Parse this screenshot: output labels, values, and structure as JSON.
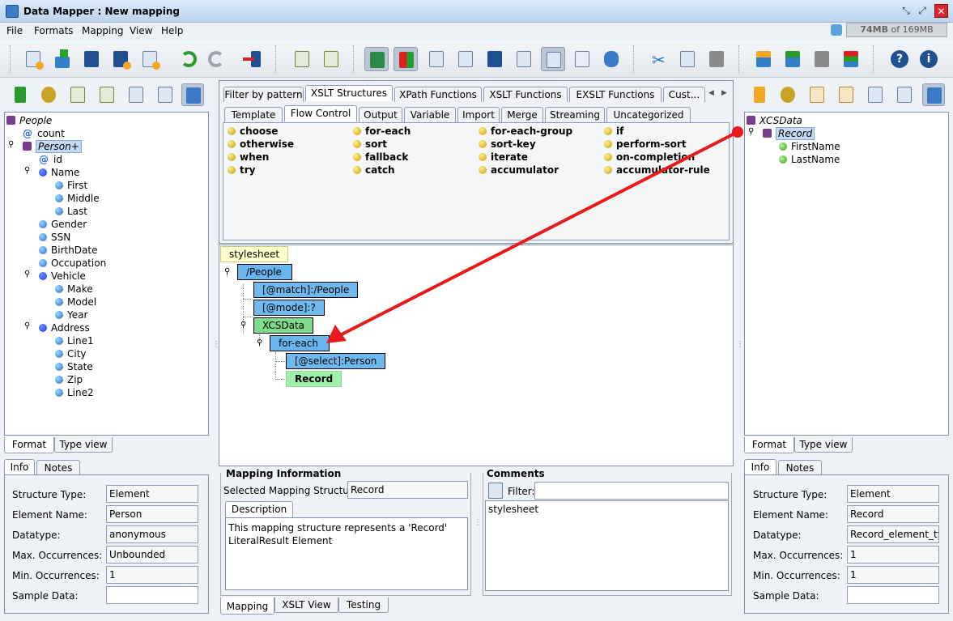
{
  "window": {
    "title": "Data Mapper : New mapping"
  },
  "menu": [
    "File",
    "Formats",
    "Mapping",
    "View",
    "Help"
  ],
  "memory": {
    "used": "74MB",
    "of": "of 169MB"
  },
  "source_tree": {
    "root": "People",
    "items": [
      "count",
      "Person+",
      "id",
      "Name",
      "First",
      "Middle",
      "Last",
      "Gender",
      "SSN",
      "BirthDate",
      "Occupation",
      "Vehicle",
      "Make",
      "Model",
      "Year",
      "Address",
      "Line1",
      "City",
      "State",
      "Zip",
      "Line2"
    ]
  },
  "target_tree": {
    "root": "XCSData",
    "items": [
      "Record",
      "FirstName",
      "LastName"
    ]
  },
  "palette": {
    "tabs_top": [
      "Filter by pattern",
      "XSLT Structures",
      "XPath Functions",
      "XSLT Functions",
      "EXSLT Functions",
      "Cust..."
    ],
    "tabs_sub": [
      "Template",
      "Flow Control",
      "Output",
      "Variable",
      "Import",
      "Merge",
      "Streaming",
      "Uncategorized"
    ],
    "items": [
      [
        "choose",
        "otherwise",
        "when",
        "try"
      ],
      [
        "for-each",
        "sort",
        "fallback",
        "catch"
      ],
      [
        "for-each-group",
        "sort-key",
        "iterate",
        "accumulator"
      ],
      [
        "if",
        "perform-sort",
        "on-completion",
        "accumulator-rule"
      ]
    ]
  },
  "mapping_tree": {
    "stylesheet": "stylesheet",
    "people": "/People",
    "match": "[@match]:/People",
    "mode": "[@mode]:?",
    "xcsdata": "XCSData",
    "foreach": "for-each",
    "select": "[@select]:Person",
    "record": "Record"
  },
  "left_bottom": {
    "tabs1": [
      "Format",
      "Type view"
    ],
    "tabs2": [
      "Info",
      "Notes"
    ],
    "labels": [
      "Structure Type:",
      "Element Name:",
      "Datatype:",
      "Max. Occurrences:",
      "Min. Occurrences:",
      "Sample Data:"
    ],
    "values": [
      "Element",
      "Person",
      "anonymous",
      "Unbounded",
      "1",
      ""
    ]
  },
  "right_bottom": {
    "tabs1": [
      "Format",
      "Type view"
    ],
    "tabs2": [
      "Info",
      "Notes"
    ],
    "labels": [
      "Structure Type:",
      "Element Name:",
      "Datatype:",
      "Max. Occurrences:",
      "Min. Occurrences:",
      "Sample Data:"
    ],
    "values": [
      "Element",
      "Record",
      "Record_element_ty",
      "1",
      "1",
      ""
    ]
  },
  "mapping_info": {
    "title": "Mapping Information",
    "selected_label": "Selected Mapping Structure:",
    "selected_value": "Record",
    "desc_tab": "Description",
    "description_line1": "This mapping structure represents a 'Record'",
    "description_line2": "LiteralResult Element"
  },
  "comments": {
    "title": "Comments",
    "filter_label": "Filter:",
    "text": "stylesheet"
  },
  "bottom_tabs": [
    "Mapping",
    "XSLT View",
    "Testing"
  ],
  "colors": {
    "arrow": "#e61b1b",
    "node_blue": "#67b6f0",
    "node_green": "#7fdc8d",
    "titlebar": "#bcd3ef"
  }
}
